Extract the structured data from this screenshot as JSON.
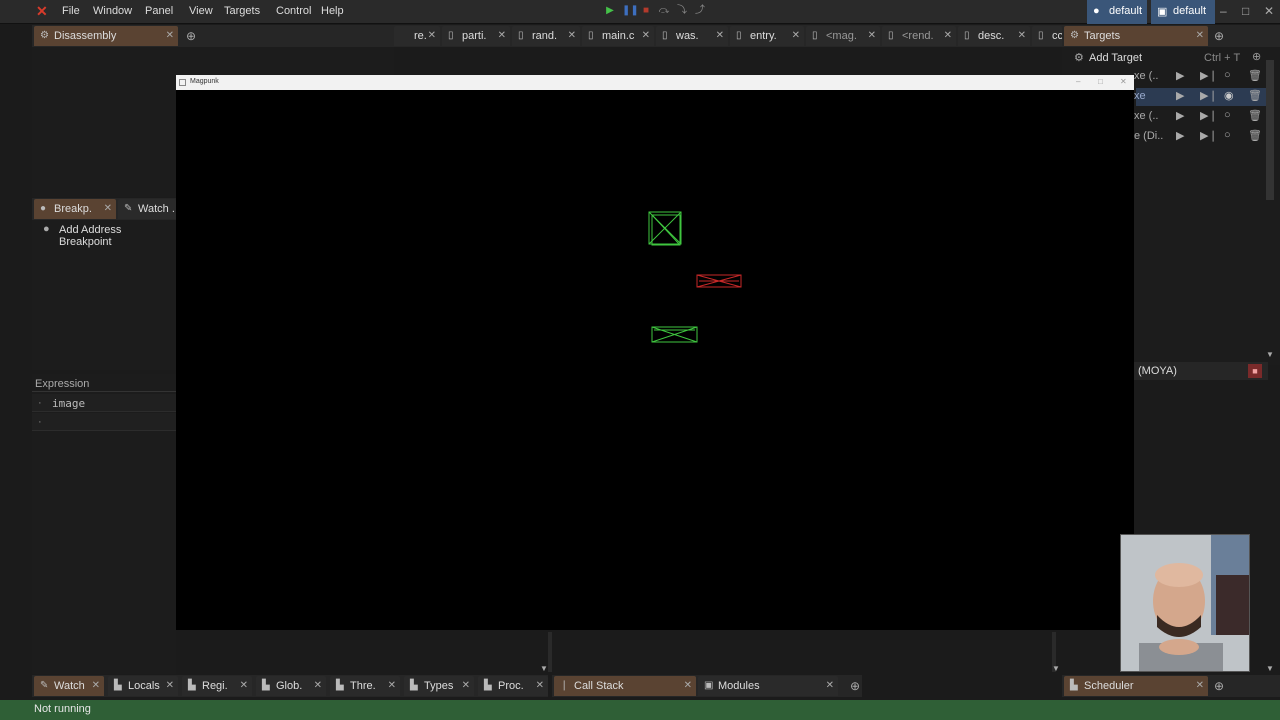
{
  "menubar": {
    "items": [
      "File",
      "Window",
      "Panel",
      "View",
      "Targets",
      "Control",
      "Help"
    ],
    "profiles": [
      "default",
      "default"
    ]
  },
  "top_left_panel": {
    "tab": "Disassembly"
  },
  "source_tabs": [
    "re.",
    "parti.",
    "rand.",
    "main.c",
    "was.",
    "entry.",
    "<mag.",
    "<rend.",
    "desc.",
    "cc"
  ],
  "targets_panel": {
    "tab": "Targets",
    "add_label": "Add Target",
    "shortcut": "Ctrl + T",
    "rows": [
      "xe (..",
      "xe",
      "xe (..",
      "e (Di.."
    ],
    "thread_label": "(MOYA)"
  },
  "breakpoints_panel": {
    "tabs": [
      "Breakp.",
      "Watch ."
    ],
    "add_label": "Add Address Breakpoint"
  },
  "watch_expr": {
    "header": "Expression",
    "rows": [
      "image",
      ""
    ]
  },
  "game_window": {
    "title": "Magpunk"
  },
  "bottom_tabs_left": [
    "Watch",
    "Locals",
    "Regi.",
    "Glob.",
    "Thre.",
    "Types",
    "Proc."
  ],
  "bottom_tabs_mid": [
    "Call Stack",
    "Modules"
  ],
  "bottom_tabs_right": [
    "Scheduler"
  ],
  "status": {
    "text": "Not running"
  },
  "colors": {
    "status_green": "#2f5f36",
    "accent_orange": "#5a4332",
    "box_green": "#3fc63f",
    "box_red": "#c62828"
  }
}
